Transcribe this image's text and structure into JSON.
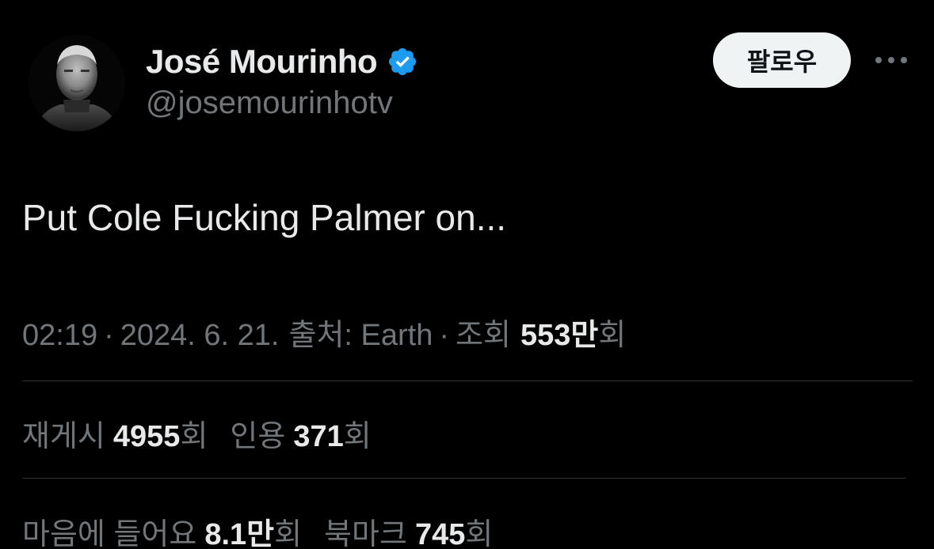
{
  "profile": {
    "display_name": "José Mourinho",
    "handle": "@josemourinhotv",
    "avatar_icon": "profile-photo",
    "verified_icon": "verified-badge-icon",
    "verified_color": "#1d9bf0"
  },
  "header": {
    "follow_label": "팔로우",
    "more_icon": "more-dots-icon"
  },
  "tweet": {
    "text": "Put Cole Fucking Palmer on..."
  },
  "meta": {
    "time": "02:19",
    "date": "2024. 6. 21.",
    "source_label": "출처: Earth",
    "views_prefix": "조회",
    "views_value": "553만",
    "views_suffix": "회",
    "separator": "·"
  },
  "stats": {
    "reposts_label": "재게시",
    "reposts_value": "4955",
    "reposts_suffix": "회",
    "quotes_label": "인용",
    "quotes_value": "371",
    "quotes_suffix": "회",
    "likes_label": "마음에 들어요",
    "likes_value": "8.1만",
    "likes_suffix": "회",
    "bookmarks_label": "북마크",
    "bookmarks_value": "745",
    "bookmarks_suffix": "회"
  },
  "colors": {
    "background": "#000000",
    "primary_text": "#e7e9ea",
    "secondary_text": "#71767b",
    "divider": "#2f3336",
    "button_bg": "#eff3f4",
    "button_text": "#0f1419"
  }
}
